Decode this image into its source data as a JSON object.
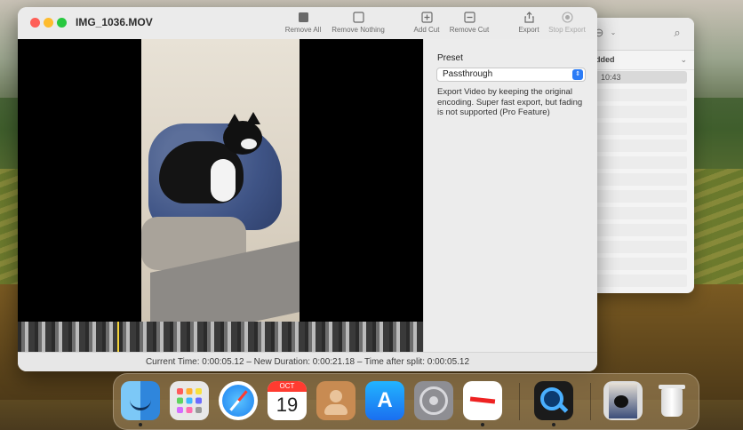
{
  "main_window": {
    "title": "IMG_1036.MOV",
    "toolbar": {
      "remove_all": "Remove All",
      "remove_nothing": "Remove Nothing",
      "add_cut": "Add Cut",
      "remove_cut": "Remove Cut",
      "export": "Export",
      "stop_export": "Stop Export"
    },
    "side_panel": {
      "preset_label": "Preset",
      "preset_value": "Passthrough",
      "preset_description": "Export Video by keeping the original encoding. Super fast export, but fading is not supported (Pro Feature)"
    },
    "status_text": "Current Time: 0:00:05.12 – New Duration: 0:00:21.18 – Time after split: 0:00:05.12"
  },
  "back_window": {
    "column_header": "dded",
    "first_row_time": "10:43"
  },
  "dock": {
    "items": [
      {
        "name": "finder-icon"
      },
      {
        "name": "launchpad-icon"
      },
      {
        "name": "safari-icon"
      },
      {
        "name": "calendar-icon",
        "month": "OCT",
        "day": "19"
      },
      {
        "name": "contacts-icon"
      },
      {
        "name": "app-store-icon"
      },
      {
        "name": "system-settings-icon"
      },
      {
        "name": "losslesscut-icon"
      },
      {
        "name": "quicktime-icon"
      },
      {
        "name": "photo-thumbnail-icon"
      },
      {
        "name": "trash-icon"
      }
    ]
  }
}
